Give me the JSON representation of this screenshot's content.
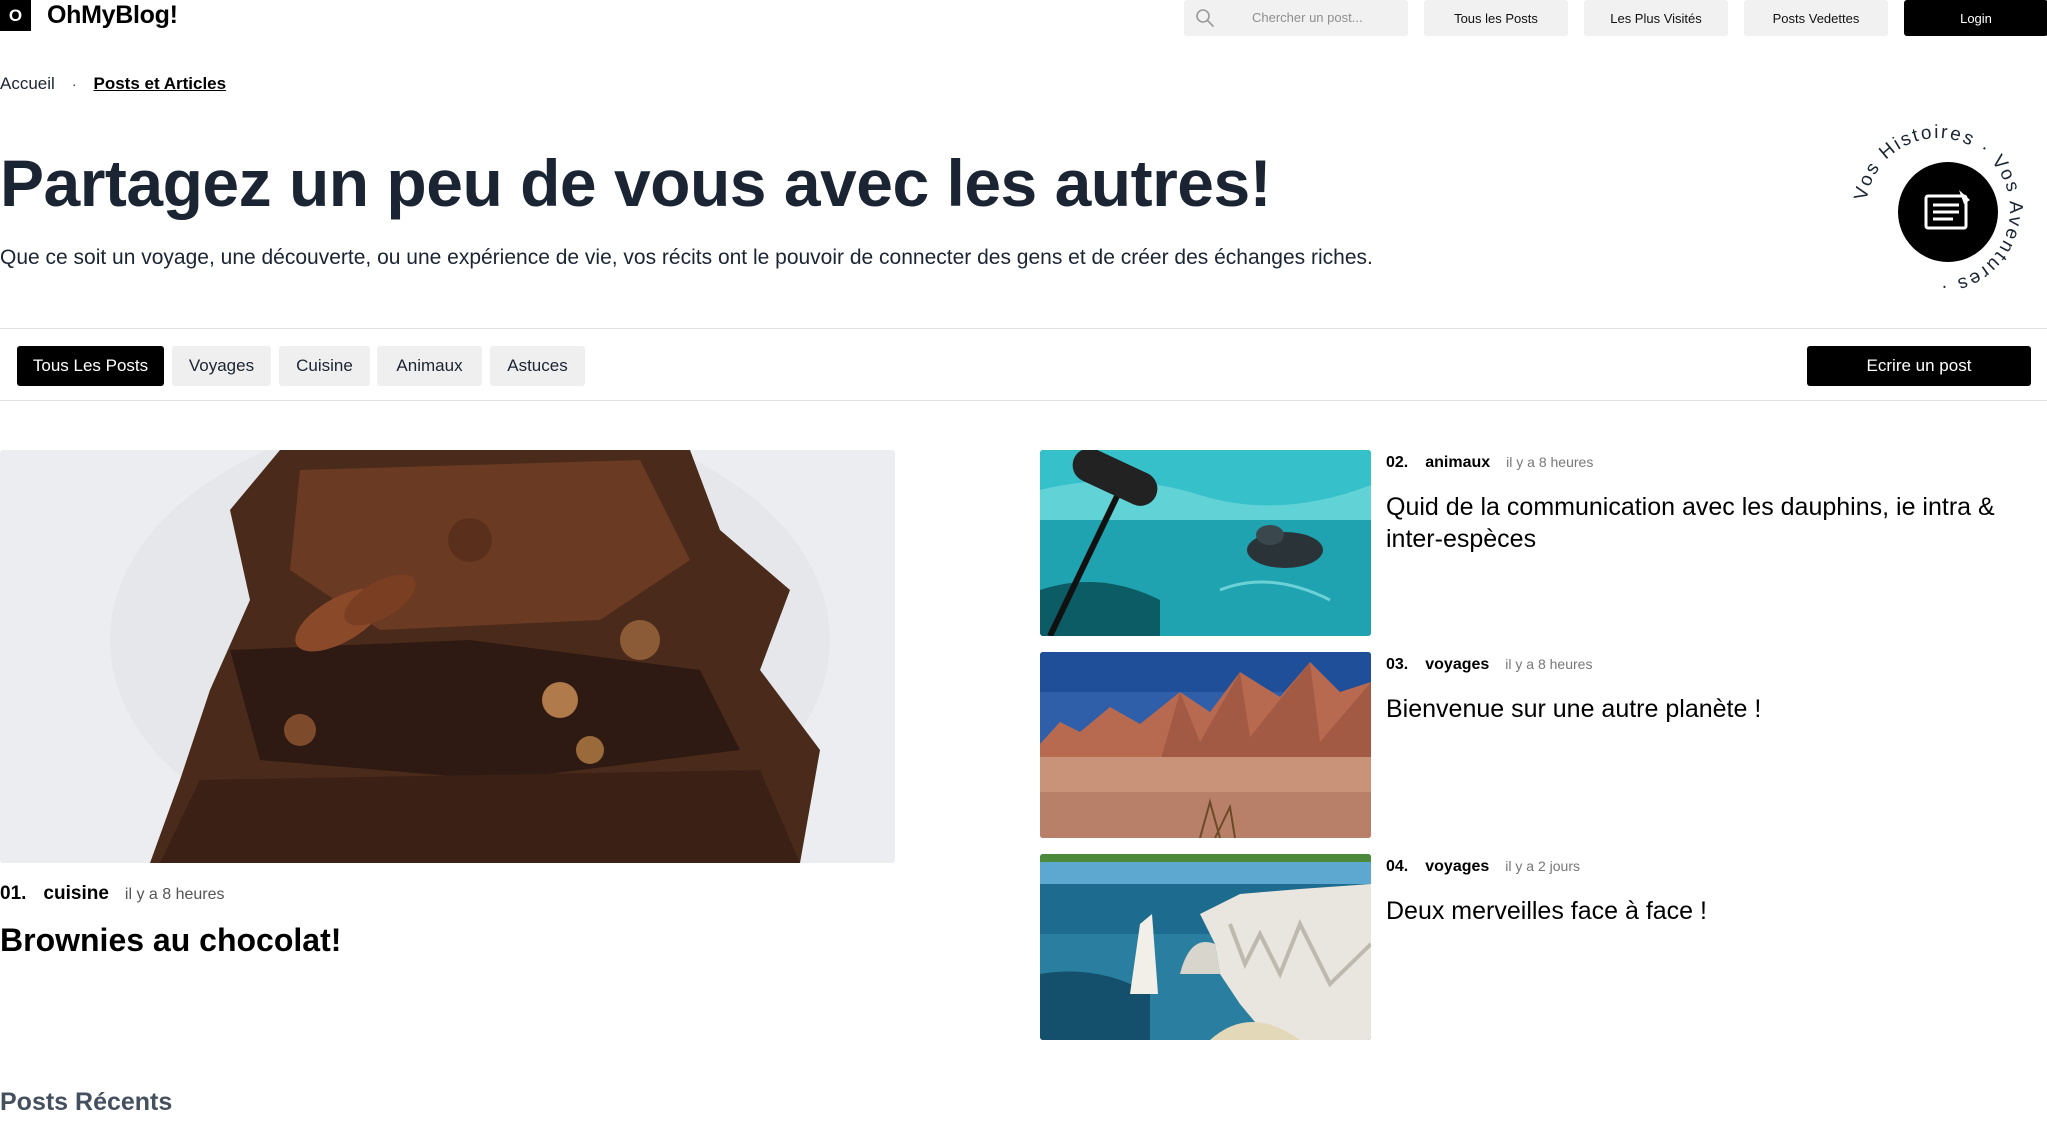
{
  "brand": {
    "logo_letter": "O",
    "name": "OhMyBlog!"
  },
  "header": {
    "search_placeholder": "Chercher un post...",
    "nav": [
      "Tous les Posts",
      "Les Plus Visités",
      "Posts Vedettes"
    ],
    "login_label": "Login"
  },
  "breadcrumb": {
    "home": "Accueil",
    "separator": "·",
    "current": "Posts et Articles"
  },
  "hero": {
    "title": "Partagez un peu de vous avec les autres!",
    "subtitle": "Que ce soit un voyage, une découverte, ou une expérience de vie, vos récits ont le pouvoir de connecter des gens et de créer des échanges riches.",
    "badge_text": "Vos Histoires · Vos Aventures ·"
  },
  "filters": {
    "chips": [
      "Tous Les Posts",
      "Voyages",
      "Cuisine",
      "Animaux",
      "Astuces"
    ],
    "active_index": 0,
    "write_label": "Ecrire un post"
  },
  "featured": {
    "number": "01.",
    "category": "cuisine",
    "time": "il y a 8 heures",
    "title": "Brownies au chocolat!",
    "image": "brownies-photo"
  },
  "side_posts": [
    {
      "number": "02.",
      "category": "animaux",
      "time": "il y a 8 heures",
      "title": "Quid de la communication avec les dauphins, ie intra & inter-espèces",
      "image": "dolphin-water-photo"
    },
    {
      "number": "03.",
      "category": "voyages",
      "time": "il y a 8 heures",
      "title": "Bienvenue sur une autre planète !",
      "image": "red-desert-photo"
    },
    {
      "number": "04.",
      "category": "voyages",
      "time": "il y a 2 jours",
      "title": "Deux merveilles face à face !",
      "image": "white-cliffs-photo"
    }
  ],
  "recent_heading": "Posts Récents",
  "colors": {
    "primary": "#000000",
    "text_dark": "#1b2433",
    "chip_bg": "#efefef",
    "muted": "#777777"
  }
}
